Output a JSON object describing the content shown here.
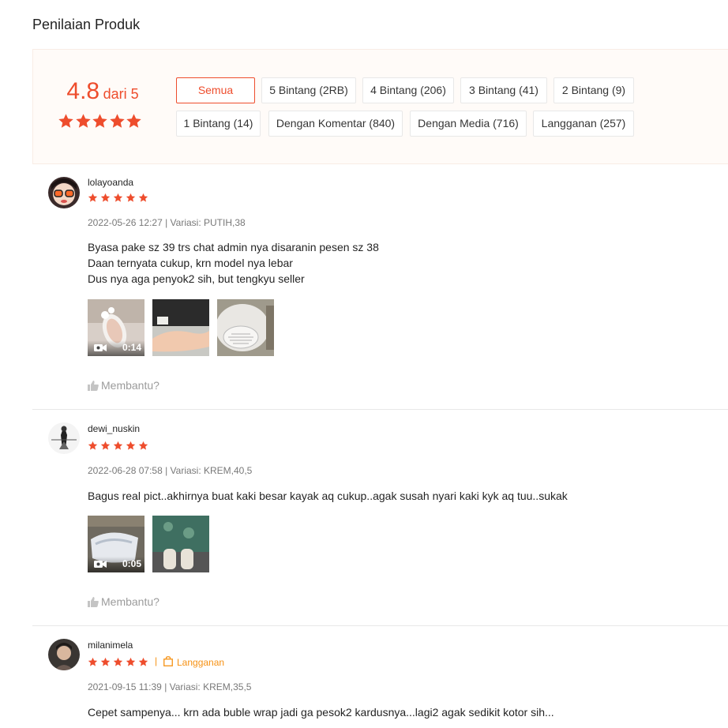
{
  "section_title": "Penilaian Produk",
  "overview": {
    "rating_value": "4.8",
    "rating_suffix": "dari 5",
    "stars": 5,
    "filters": [
      "Semua",
      "5 Bintang (2RB)",
      "4 Bintang (206)",
      "3 Bintang (41)",
      "2 Bintang (9)",
      "1 Bintang (14)",
      "Dengan Komentar (840)",
      "Dengan Media (716)",
      "Langganan (257)"
    ]
  },
  "reviews": [
    {
      "username": "lolayoanda",
      "stars": 5,
      "meta": "2022-05-26 12:27 | Variasi: PUTIH,38",
      "comment": "Byasa pake sz 39 trs chat admin nya disaranin pesen sz 38\nDaan ternyata cukup, krn model nya lebar\nDus nya aga penyok2 sih, but tengkyu seller",
      "video_duration": "0:14",
      "helpful": "Membantu?"
    },
    {
      "username": "dewi_nuskin",
      "stars": 5,
      "meta": "2022-06-28 07:58 | Variasi: KREM,40,5",
      "comment": "Bagus real pict..akhirnya buat kaki besar kayak aq cukup..agak susah nyari kaki kyk aq tuu..sukak",
      "video_duration": "0:05",
      "helpful": "Membantu?"
    },
    {
      "username": "milanimela",
      "stars": 5,
      "badge": "Langganan",
      "meta": "2021-09-15 11:39 | Variasi: KREM,35,5",
      "comment": "Cepet sampenya... krn ada buble wrap jadi ga pesok2 kardusnya...lagi2 agak sedikit kotor sih..."
    }
  ],
  "colors": {
    "accent": "#ee4d2d",
    "subscription": "#f69113"
  }
}
